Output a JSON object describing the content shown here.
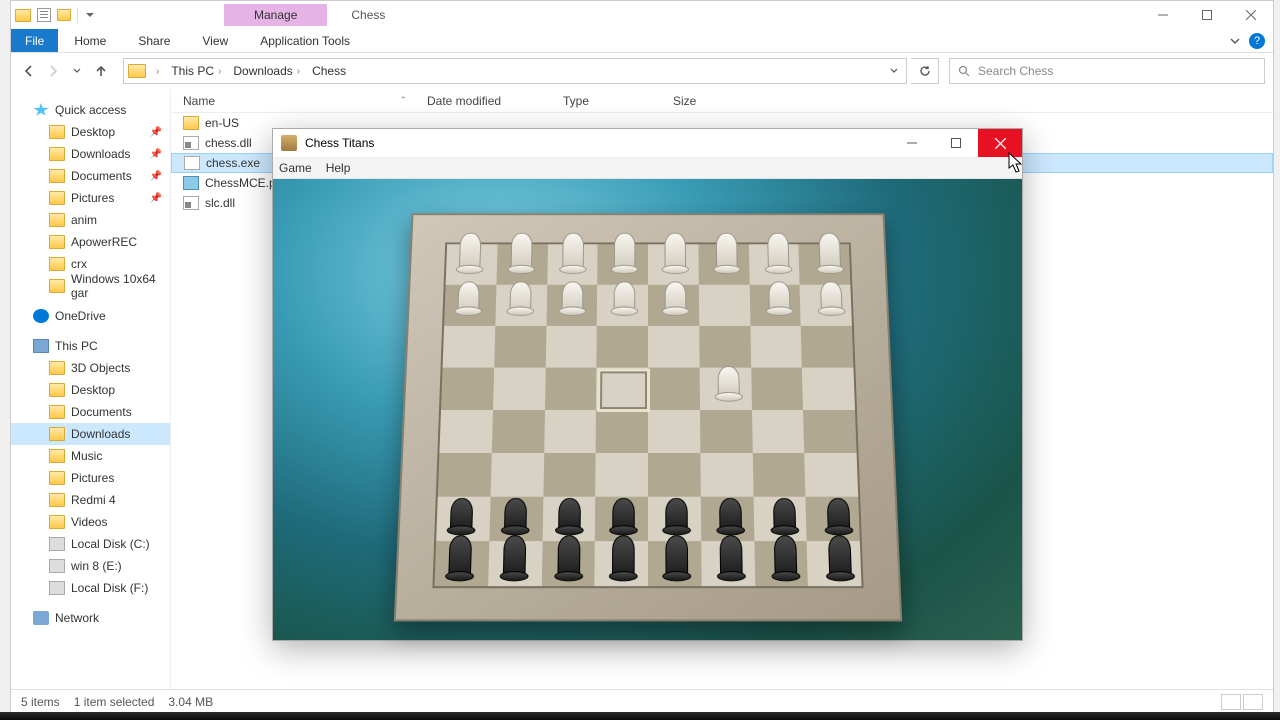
{
  "explorer": {
    "ribbon": {
      "contextual_group": "Manage",
      "contextual_title": "Chess",
      "file": "File",
      "tabs": [
        "Home",
        "Share",
        "View"
      ],
      "app_tools": "Application Tools"
    },
    "breadcrumb": {
      "segments": [
        "This PC",
        "Downloads",
        "Chess"
      ]
    },
    "search_placeholder": "Search Chess",
    "columns": {
      "name": "Name",
      "date": "Date modified",
      "type": "Type",
      "size": "Size"
    },
    "navpane": {
      "quick_access": "Quick access",
      "qa_items": [
        {
          "label": "Desktop",
          "pinned": true
        },
        {
          "label": "Downloads",
          "pinned": true
        },
        {
          "label": "Documents",
          "pinned": true
        },
        {
          "label": "Pictures",
          "pinned": true
        },
        {
          "label": "anim",
          "pinned": false
        },
        {
          "label": "ApowerREC",
          "pinned": false
        },
        {
          "label": "crx",
          "pinned": false
        },
        {
          "label": "Windows 10x64 gar",
          "pinned": false
        }
      ],
      "onedrive": "OneDrive",
      "this_pc": "This PC",
      "pc_items": [
        "3D Objects",
        "Desktop",
        "Documents",
        "Downloads",
        "Music",
        "Pictures",
        "Redmi 4",
        "Videos",
        "Local Disk (C:)",
        "win 8 (E:)",
        "Local Disk (F:)"
      ],
      "network": "Network"
    },
    "files": [
      {
        "name": "en-US",
        "type": "folder"
      },
      {
        "name": "chess.dll",
        "type": "dll"
      },
      {
        "name": "chess.exe",
        "type": "exe",
        "selected": true
      },
      {
        "name": "ChessMCE.png",
        "type": "png"
      },
      {
        "name": "slc.dll",
        "type": "dll"
      }
    ],
    "status": {
      "items": "5 items",
      "selected": "1 item selected",
      "size": "3.04 MB"
    }
  },
  "chess": {
    "title": "Chess Titans",
    "menu": [
      "Game",
      "Help"
    ]
  }
}
